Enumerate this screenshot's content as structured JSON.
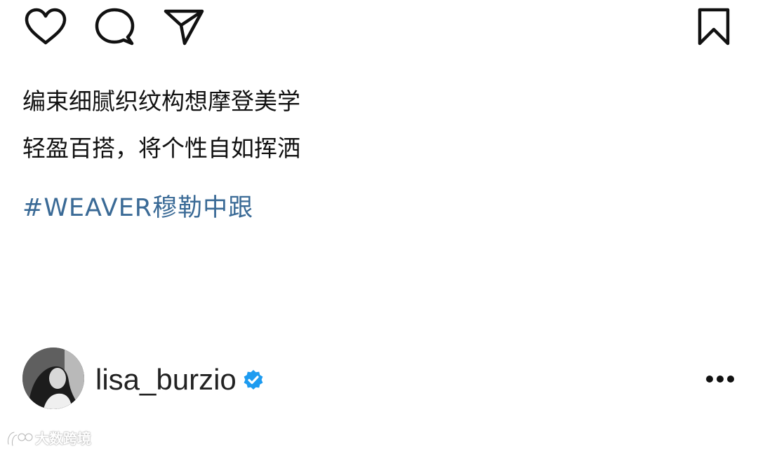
{
  "actions": {
    "like": "heart-icon",
    "comment": "comment-icon",
    "share": "send-icon",
    "save": "bookmark-icon"
  },
  "caption": {
    "lines": [
      "编束细腻织纹构想摩登美学",
      "轻盈百搭，将个性自如挥洒"
    ],
    "hashtag": "#WEAVER穆勒中跟"
  },
  "author": {
    "username": "lisa_burzio",
    "verified": true,
    "badge_color": "#1d9bf0"
  },
  "watermark": {
    "text": "大数跨境"
  },
  "colors": {
    "hashtag": "#3a6a96",
    "text": "#111111",
    "background": "#ffffff"
  }
}
